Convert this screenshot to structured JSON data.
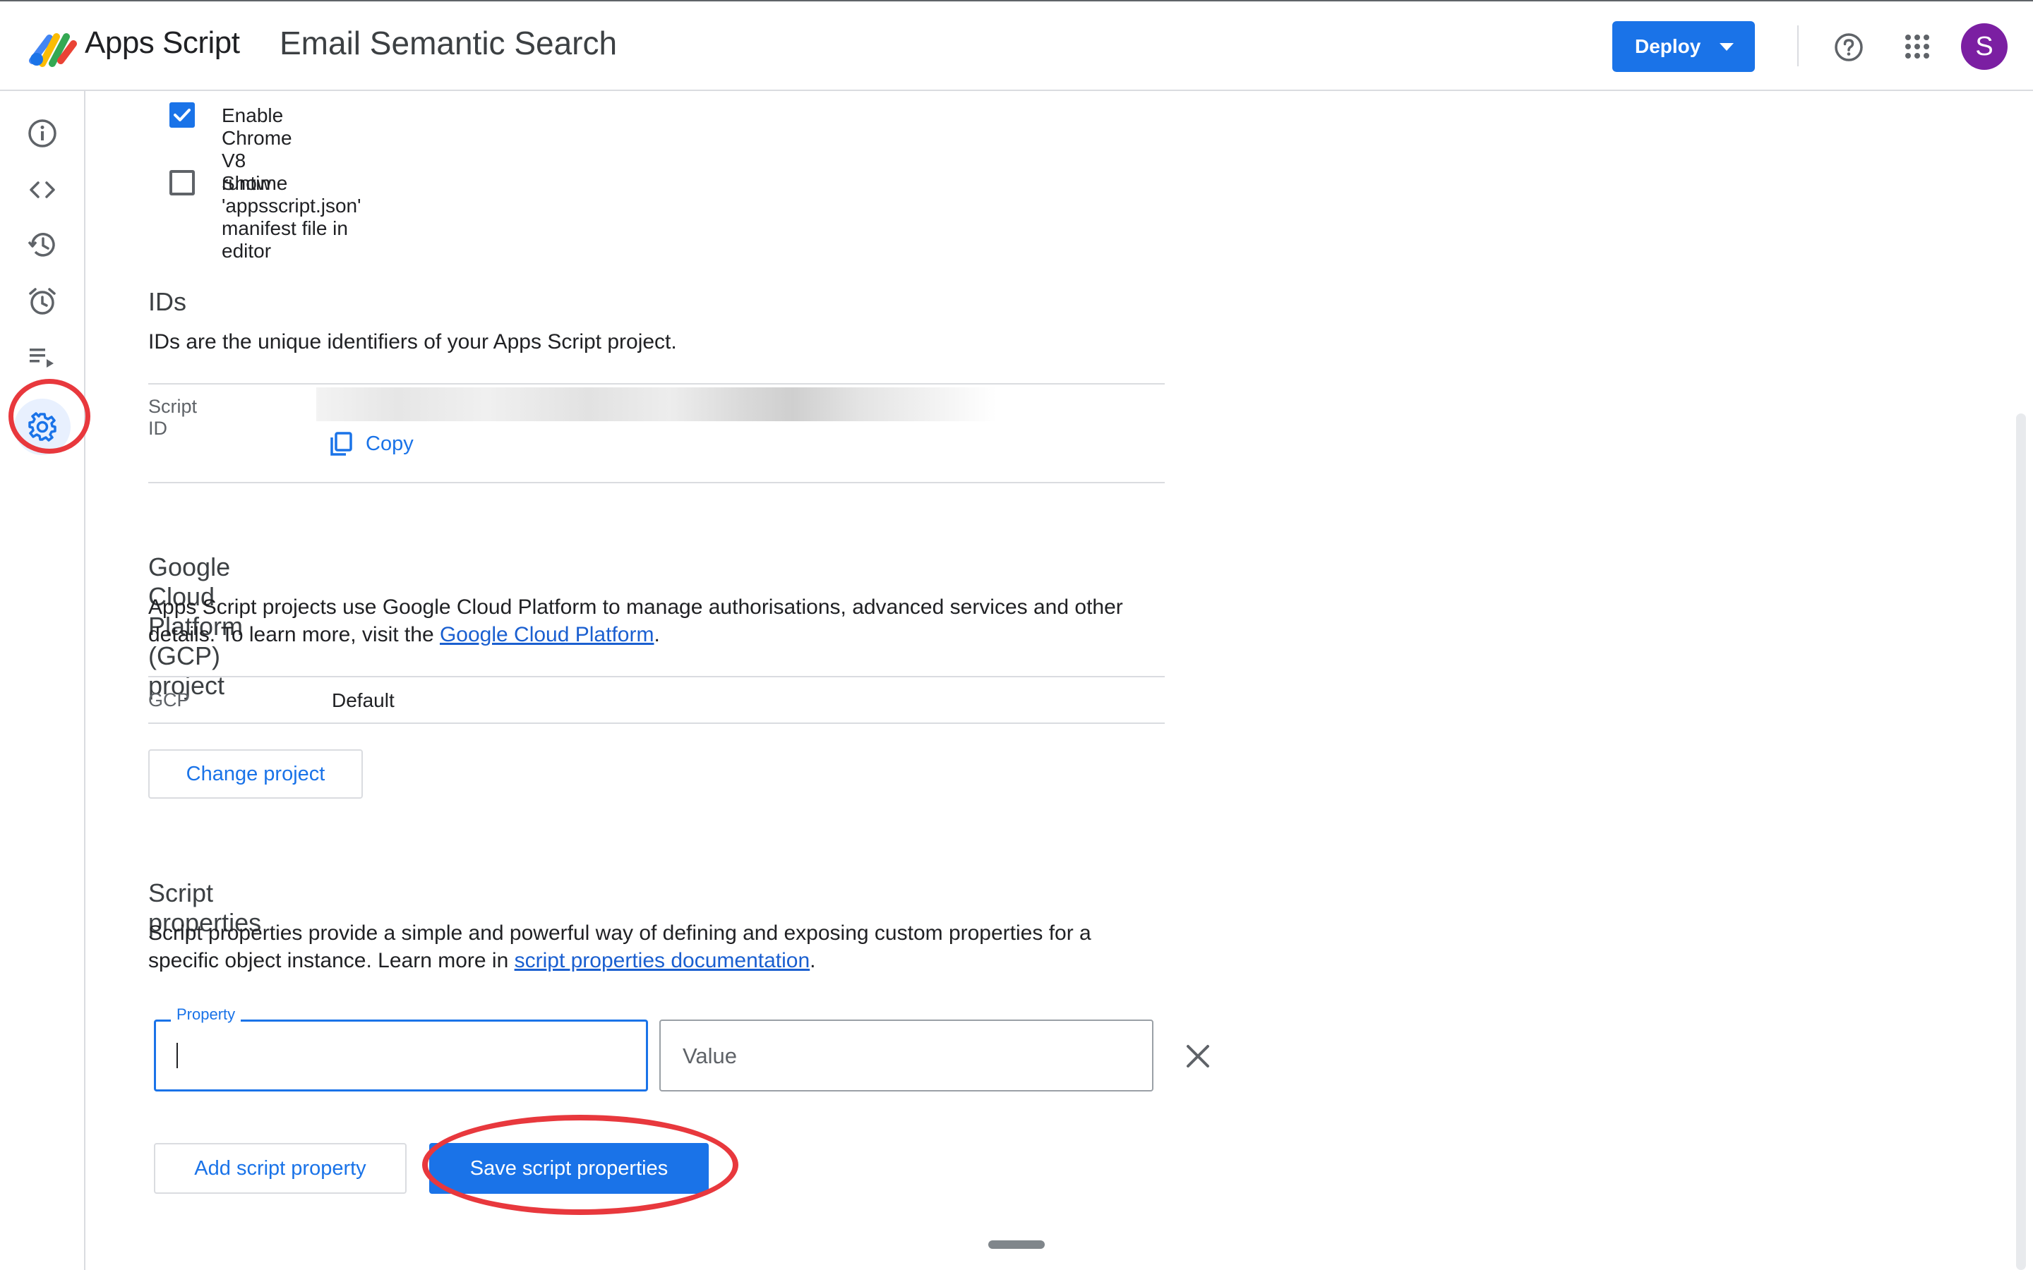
{
  "header": {
    "app_name": "Apps Script",
    "project_title": "Email Semantic Search",
    "deploy_label": "Deploy",
    "avatar_letter": "S"
  },
  "sidebar": {
    "items": [
      {
        "icon": "info-icon",
        "label": "Overview"
      },
      {
        "icon": "code-icon",
        "label": "Editor"
      },
      {
        "icon": "history-icon",
        "label": "Project history"
      },
      {
        "icon": "alarm-icon",
        "label": "Triggers"
      },
      {
        "icon": "executions-icon",
        "label": "Executions"
      },
      {
        "icon": "gear-icon",
        "label": "Project Settings",
        "active": true
      }
    ]
  },
  "general": {
    "v8_label": "Enable Chrome V8 runtime",
    "v8_checked": true,
    "manifest_label": "Show 'appsscript.json' manifest file in editor",
    "manifest_checked": false
  },
  "ids": {
    "title": "IDs",
    "description": "IDs are the unique identifiers of your Apps Script project.",
    "script_id_key": "Script ID",
    "copy_label": "Copy"
  },
  "gcp": {
    "title": "Google Cloud Platform (GCP) project",
    "description_prefix": "Apps Script projects use Google Cloud Platform to manage authorisations, advanced services and other details. To learn more, visit the ",
    "link_text": "Google Cloud Platform",
    "description_suffix": ".",
    "key": "GCP",
    "value": "Default",
    "change_label": "Change project"
  },
  "script_props": {
    "title": "Script properties",
    "description_prefix": "Script properties provide a simple and powerful way of defining and exposing custom properties for a specific object instance. Learn more in ",
    "link_text": "script properties documentation",
    "description_suffix": ".",
    "property_label": "Property",
    "property_value": "",
    "value_placeholder": "Value",
    "add_label": "Add script property",
    "save_label": "Save script properties"
  },
  "colors": {
    "accent": "#1a73e8",
    "annotation": "#e8383d",
    "avatar": "#7b1fa2"
  }
}
